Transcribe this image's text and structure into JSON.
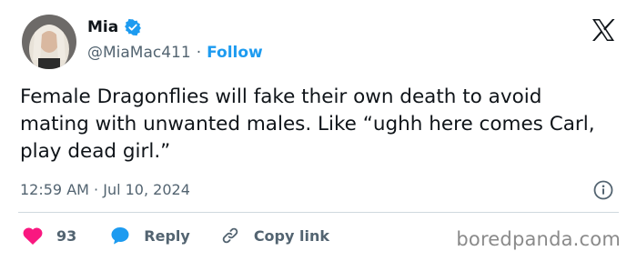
{
  "user": {
    "name": "Mia",
    "handle": "@MiaMac411",
    "follow_label": "Follow",
    "separator": "·"
  },
  "tweet": {
    "text": "Female Dragonflies will fake their own death to avoid mating with unwanted males. Like “ughh here comes Carl, play dead girl.”",
    "time": "12:59 AM",
    "date": "Jul 10, 2024",
    "separator": "·"
  },
  "actions": {
    "like_count": "93",
    "reply_label": "Reply",
    "copy_label": "Copy link"
  },
  "watermark": "boredpanda.com",
  "colors": {
    "accent": "#1d9bf0",
    "like": "#f91880",
    "text": "#0f1419",
    "muted": "#536471"
  },
  "icons": [
    "avatar",
    "verified-badge-icon",
    "x-logo-icon",
    "info-icon",
    "heart-icon",
    "reply-bubble-icon",
    "link-icon"
  ]
}
